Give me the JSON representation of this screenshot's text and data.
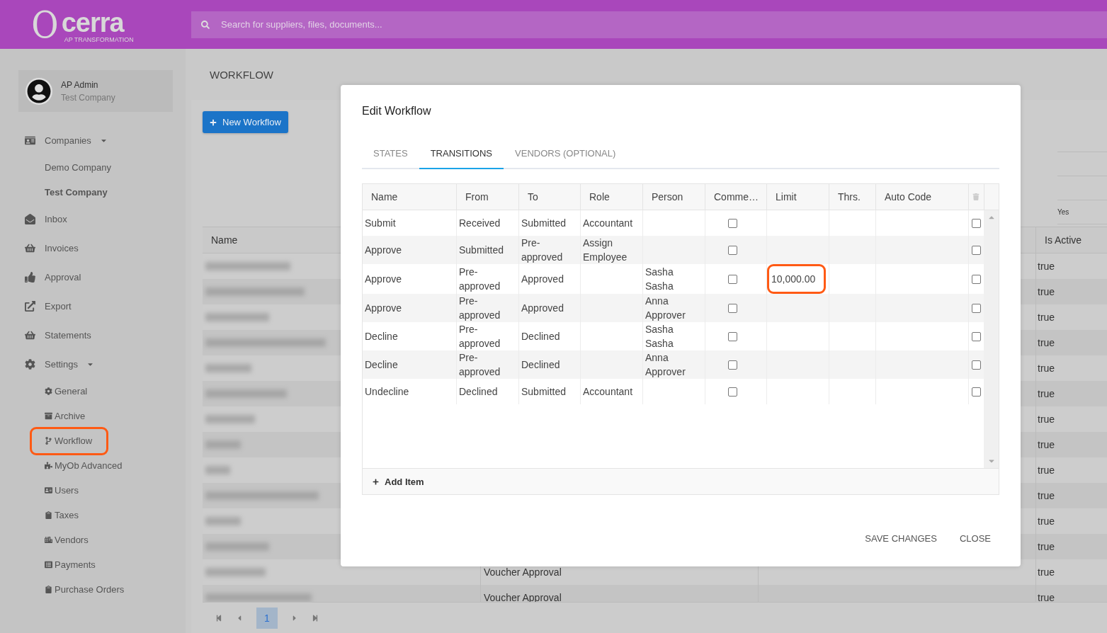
{
  "app": {
    "logo": {
      "mark": "O",
      "name": "cerra",
      "tagline": "AP TRANSFORMATION"
    },
    "search": {
      "placeholder": "Search for suppliers, files, documents..."
    }
  },
  "user": {
    "name": "AP Admin",
    "company": "Test Company"
  },
  "sidebar": {
    "items": [
      {
        "label": "Companies",
        "expanded": true,
        "children": [
          {
            "label": "Demo Company",
            "selected": false,
            "highlighted": false
          },
          {
            "label": "Test Company",
            "selected": true,
            "highlighted": false
          }
        ]
      },
      {
        "label": "Inbox"
      },
      {
        "label": "Invoices"
      },
      {
        "label": "Approval"
      },
      {
        "label": "Export"
      },
      {
        "label": "Statements"
      },
      {
        "label": "Settings",
        "expanded": true,
        "children": [
          {
            "label": "General",
            "selected": false,
            "highlighted": false
          },
          {
            "label": "Archive",
            "selected": false,
            "highlighted": false
          },
          {
            "label": "Workflow",
            "selected": false,
            "highlighted": true
          },
          {
            "label": "MyOb Advanced",
            "selected": false,
            "highlighted": false
          },
          {
            "label": "Users",
            "selected": false,
            "highlighted": false
          },
          {
            "label": "Taxes",
            "selected": false,
            "highlighted": false
          },
          {
            "label": "Vendors",
            "selected": false,
            "highlighted": false
          },
          {
            "label": "Payments",
            "selected": false,
            "highlighted": false
          },
          {
            "label": "Purchase Orders",
            "selected": false,
            "highlighted": false
          }
        ]
      }
    ]
  },
  "page": {
    "title": "WORKFLOW",
    "new_button": "New Workflow",
    "filter_value": "Yes",
    "table": {
      "name_header": "Name",
      "is_active_header": "Is Active",
      "rows": [
        {
          "is_active": "true"
        },
        {
          "is_active": "true"
        },
        {
          "is_active": "true"
        },
        {
          "is_active": "true"
        },
        {
          "is_active": "true"
        },
        {
          "is_active": "true"
        },
        {
          "is_active": "true"
        },
        {
          "is_active": "true"
        },
        {
          "is_active": "true"
        },
        {
          "is_active": "true"
        },
        {
          "is_active": "true"
        },
        {
          "is_active": "true"
        },
        {
          "column_2": "Voucher Approval",
          "is_active": "true"
        },
        {
          "column_2": "Voucher Approval",
          "is_active": "true"
        }
      ]
    },
    "pagination": {
      "pages": [
        {
          "label": "1",
          "selected": true
        }
      ]
    }
  },
  "modal": {
    "title": "Edit Workflow",
    "tabs": [
      {
        "label": "STATES",
        "selected": false
      },
      {
        "label": "TRANSITIONS",
        "selected": true
      },
      {
        "label": "VENDORS (OPTIONAL)",
        "selected": false
      }
    ],
    "columns": [
      "Name",
      "From",
      "To",
      "Role",
      "Person",
      "Comme…",
      "Limit",
      "Thrs.",
      "Auto Code"
    ],
    "rows": [
      {
        "name": "Submit",
        "from": "Received",
        "to": "Submitted",
        "role": "Accountant",
        "comments": false,
        "selected": false
      },
      {
        "name": "Approve",
        "from": "Submitted",
        "to": "Pre-approved",
        "role": "Assign Employee",
        "comments": false,
        "selected": false
      },
      {
        "name": "Approve",
        "from": "Pre-approved",
        "to": "Approved",
        "person": "Sasha Sasha",
        "comments": false,
        "limit": "10,000.00",
        "limit_highlighted": true,
        "selected": false
      },
      {
        "name": "Approve",
        "from": "Pre-approved",
        "to": "Approved",
        "person": "Anna Approver",
        "comments": false,
        "selected": false
      },
      {
        "name": "Decline",
        "from": "Pre-approved",
        "to": "Declined",
        "person": "Sasha Sasha",
        "comments": false,
        "selected": false
      },
      {
        "name": "Decline",
        "from": "Pre-approved",
        "to": "Declined",
        "person": "Anna Approver",
        "comments": false,
        "selected": false
      },
      {
        "name": "Undecline",
        "from": "Declined",
        "to": "Submitted",
        "role": "Accountant",
        "comments": false,
        "selected": false
      }
    ],
    "add_item": "Add Item",
    "buttons": [
      "SAVE CHANGES",
      "CLOSE"
    ]
  }
}
